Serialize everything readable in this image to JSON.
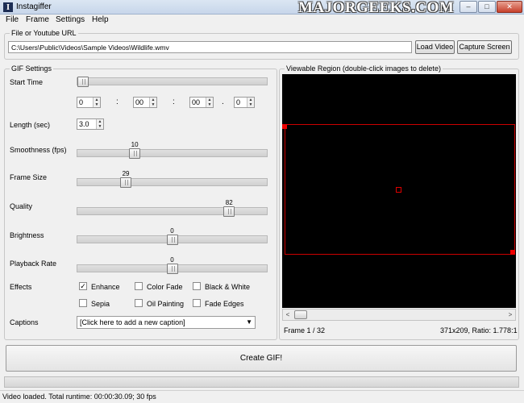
{
  "window": {
    "title": "Instagiffer",
    "icon_glyph": "I",
    "watermark": "MAJORGEEKS.COM",
    "controls": {
      "minimize": "–",
      "maximize": "□",
      "close": "✕"
    }
  },
  "menu": [
    "File",
    "Frame",
    "Settings",
    "Help"
  ],
  "source": {
    "group_label": "File or Youtube URL",
    "path_value": "C:\\Users\\Public\\Videos\\Sample Videos\\Wildlife.wmv",
    "load_video_label": "Load Video",
    "capture_screen_label": "Capture Screen"
  },
  "gif_settings": {
    "group_label": "GIF Settings",
    "start_time": {
      "label": "Start Time",
      "slider_fraction": 0.0,
      "hours": "0",
      "minutes": "00",
      "seconds": "00",
      "fraction": "0",
      "sep_colon": ":",
      "sep_dot": "."
    },
    "length": {
      "label": "Length (sec)",
      "value": "3.0"
    },
    "smoothness": {
      "label": "Smoothness (fps)",
      "value": "10",
      "fraction": 0.29
    },
    "frame_size": {
      "label": "Frame Size",
      "value": "29",
      "fraction": 0.24
    },
    "quality": {
      "label": "Quality",
      "value": "82",
      "fraction": 0.82
    },
    "brightness": {
      "label": "Brightness",
      "value": "0",
      "fraction": 0.5
    },
    "playback_rate": {
      "label": "Playback Rate",
      "value": "0",
      "fraction": 0.5
    },
    "effects": {
      "label": "Effects",
      "check_glyph": "✓",
      "items": [
        {
          "label": "Enhance",
          "checked": true
        },
        {
          "label": "Color Fade",
          "checked": false
        },
        {
          "label": "Black & White",
          "checked": false
        },
        {
          "label": "Sepia",
          "checked": false
        },
        {
          "label": "Oil Painting",
          "checked": false
        },
        {
          "label": "Fade Edges",
          "checked": false
        }
      ]
    },
    "captions": {
      "label": "Captions",
      "value": "[Click here to add a new caption]",
      "arrow": "▼"
    }
  },
  "viewer": {
    "group_label": "Viewable Region (double-click images to delete)",
    "frame_label": "Frame",
    "frame_current": "1",
    "frame_total": "32",
    "frame_text": "Frame  1 / 32",
    "dimensions_text": "371x209, Ratio: 1.778:1",
    "scroll_left": "<",
    "scroll_right": ">"
  },
  "create_gif_label": "Create GIF!",
  "progress_fraction": 0.0,
  "status_text": "Video loaded. Total runtime: 00:00:30.09; 30 fps"
}
